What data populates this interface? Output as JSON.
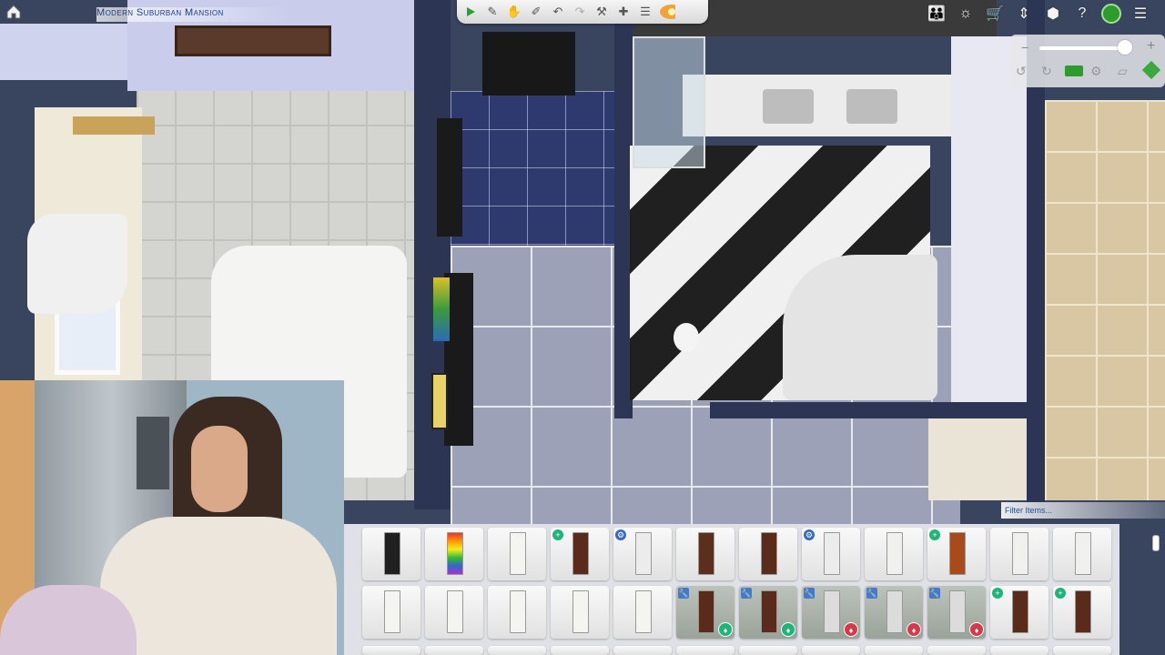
{
  "lot": {
    "title": "Modern Suburban Mansion"
  },
  "toolbar": {
    "icons": [
      "play-icon",
      "eyedropper-icon",
      "hand-icon",
      "design-tool-icon",
      "undo-icon",
      "redo-icon",
      "sledgehammer-icon",
      "move-icon",
      "stack-icon",
      "sunset-icon"
    ]
  },
  "right_tools": {
    "icons": [
      "household-icon",
      "lightbulb-icon",
      "cart-icon",
      "floor-toggle-icon",
      "camera-box-icon",
      "help-icon",
      "build-mode-icon",
      "menu-icon"
    ]
  },
  "catalog": {
    "filter_placeholder": "Filter Items...",
    "rows": [
      [
        {
          "door": "#202020"
        },
        {
          "door": "rainbow"
        },
        {
          "door": "#f4f4f0"
        },
        {
          "door": "#5a2a1a",
          "badge": "new"
        },
        {
          "door": "#ececec",
          "badge": "pack"
        },
        {
          "door": "#5c2e1c"
        },
        {
          "door": "#5a2a1a"
        },
        {
          "door": "#ececec",
          "badge": "pack"
        },
        {
          "door": "#f0f0ee"
        },
        {
          "door": "#a84a1a",
          "badge": "new"
        },
        {
          "door": "#f0f0ee"
        },
        {
          "door": "#f0f0ee"
        }
      ],
      [
        {
          "door": "#f4f4f0"
        },
        {
          "door": "#f4f4f0"
        },
        {
          "door": "#f4f4f0"
        },
        {
          "door": "#f4f4f0"
        },
        {
          "door": "#f4f4f0"
        },
        {
          "door": "#5a2a1a",
          "wrench": true,
          "bl": "green"
        },
        {
          "door": "#5a2a1a",
          "wrench": true,
          "bl": "green"
        },
        {
          "door": "#dcdcdc",
          "wrench": true,
          "bl": "red"
        },
        {
          "door": "#dcdcdc",
          "wrench": true,
          "bl": "red"
        },
        {
          "door": "#dcdcdc",
          "wrench": true,
          "bl": "red"
        },
        {
          "door": "#5a2a1a",
          "badge": "teal"
        },
        {
          "door": "#5a2a1a",
          "badge": "teal"
        }
      ]
    ]
  },
  "colors": {
    "accent": "#2d9c2d",
    "title": "#1e3f8f",
    "badge_green": "#1fb47a",
    "badge_red": "#d43a4a"
  }
}
